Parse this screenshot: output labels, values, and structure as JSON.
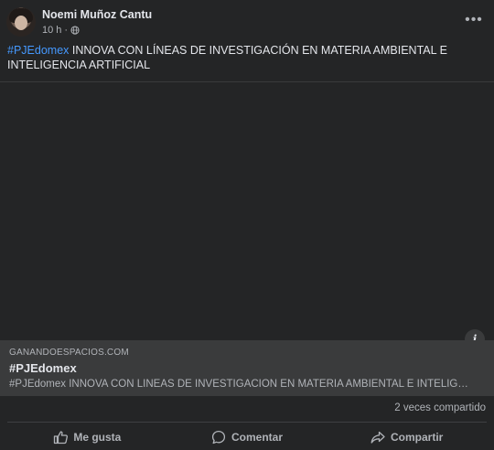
{
  "post": {
    "author": "Noemi Muñoz Cantu",
    "time": "10 h",
    "separator": "·",
    "privacy_icon": "globe-icon",
    "more_icon": "ellipsis-icon",
    "more_label": "•••",
    "hashtag": "#PJEdomex",
    "text": " INNOVA CON LÍNEAS DE INVESTIGACIÓN EN MATERIA AMBIENTAL E INTELIGENCIA ARTIFICIAL"
  },
  "media": {
    "info_label": "i"
  },
  "link_preview": {
    "domain": "GANANDOESPACIOS.COM",
    "title": "#PJEdomex",
    "description": "#PJEdomex INNOVA CON LÍNEAS DE INVESTIGACIÓN EN MATERIA AMBIENTAL E INTELIGENCIA ARTIFICIAL"
  },
  "stats": {
    "shares": "2 veces compartido"
  },
  "actions": {
    "like": "Me gusta",
    "comment": "Comentar",
    "share": "Compartir"
  },
  "colors": {
    "background": "#242526",
    "hashtag": "#4599ff",
    "secondary_text": "#b0b3b8",
    "primary_text": "#e4e6eb"
  }
}
